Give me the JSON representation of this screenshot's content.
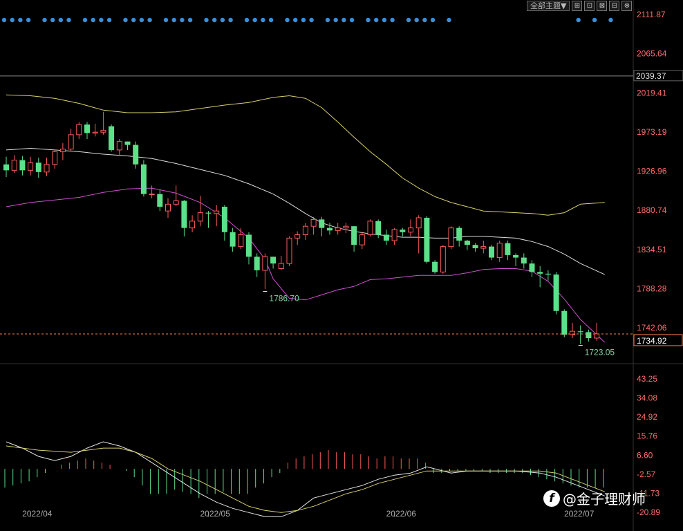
{
  "toolbar": {
    "theme_label": "全部主题▼",
    "buttons": [
      "⊞",
      "⊡",
      "⊠",
      "⊟",
      "⊗"
    ]
  },
  "watermark": {
    "logo": "f",
    "text": "@金子理财师"
  },
  "colors": {
    "up": "#ff5c5c",
    "down": "#5ce08a",
    "mid_band": "#dddddd",
    "upper_band": "#d8d070",
    "lower_band": "#d050d0",
    "dots": "#3a8fd8",
    "price_line": "#ff7f50"
  },
  "chart_data": [
    {
      "type": "candlestick",
      "y_ticks": [
        "2111.87",
        "2065.64",
        "2019.41",
        "1973.19",
        "1926.96",
        "1880.74",
        "1834.51",
        "1788.28",
        "1742.06"
      ],
      "ylim": [
        1721.0,
        2111.87
      ],
      "x_ticks": [
        "2022/04",
        "2022/05",
        "2022/06",
        "2022/07"
      ],
      "horizontal_line_label": "2039.37",
      "current_price": "1734.92",
      "annotations": [
        {
          "label": "1786.70",
          "value": 1786.7,
          "bar": 32
        },
        {
          "label": "1723.05",
          "value": 1723.05,
          "bar": 71
        }
      ],
      "candles": [
        [
          1935,
          1928,
          1944,
          1920
        ],
        [
          1928,
          1940,
          1946,
          1925
        ],
        [
          1940,
          1928,
          1945,
          1922
        ],
        [
          1928,
          1937,
          1944,
          1922
        ],
        [
          1937,
          1926,
          1943,
          1919
        ],
        [
          1926,
          1935,
          1943,
          1921
        ],
        [
          1935,
          1950,
          1952,
          1930
        ],
        [
          1950,
          1953,
          1960,
          1940
        ],
        [
          1953,
          1970,
          1977,
          1950
        ],
        [
          1970,
          1982,
          1985,
          1965
        ],
        [
          1982,
          1972,
          1985,
          1965
        ],
        [
          1972,
          1973,
          1983,
          1968
        ],
        [
          1973,
          1975,
          1997,
          1970
        ],
        [
          1980,
          1952,
          1982,
          1950
        ],
        [
          1952,
          1962,
          1965,
          1945
        ],
        [
          1962,
          1958,
          1962,
          1952
        ],
        [
          1958,
          1935,
          1962,
          1930
        ],
        [
          1935,
          1900,
          1940,
          1897
        ],
        [
          1900,
          1900,
          1910,
          1895
        ],
        [
          1900,
          1885,
          1905,
          1880
        ],
        [
          1880,
          1888,
          1895,
          1872
        ],
        [
          1888,
          1892,
          1910,
          1886
        ],
        [
          1892,
          1860,
          1893,
          1850
        ],
        [
          1860,
          1868,
          1875,
          1855
        ],
        [
          1868,
          1878,
          1898,
          1862
        ],
        [
          1878,
          1877,
          1880,
          1860
        ],
        [
          1877,
          1880,
          1887,
          1862
        ],
        [
          1885,
          1855,
          1887,
          1845
        ],
        [
          1855,
          1838,
          1860,
          1832
        ],
        [
          1838,
          1852,
          1860,
          1835
        ],
        [
          1852,
          1826,
          1855,
          1817
        ],
        [
          1826,
          1810,
          1830,
          1802
        ],
        [
          1810,
          1826,
          1830,
          1788
        ],
        [
          1826,
          1818,
          1822,
          1812
        ],
        [
          1812,
          1818,
          1827,
          1810
        ],
        [
          1818,
          1848,
          1850,
          1815
        ],
        [
          1848,
          1852,
          1856,
          1840
        ],
        [
          1852,
          1862,
          1866,
          1846
        ],
        [
          1862,
          1870,
          1873,
          1852
        ],
        [
          1870,
          1860,
          1873,
          1850
        ],
        [
          1860,
          1857,
          1866,
          1852
        ],
        [
          1857,
          1860,
          1866,
          1852
        ],
        [
          1860,
          1862,
          1866,
          1854
        ],
        [
          1862,
          1840,
          1862,
          1832
        ],
        [
          1840,
          1852,
          1855,
          1835
        ],
        [
          1852,
          1868,
          1870,
          1850
        ],
        [
          1868,
          1852,
          1870,
          1848
        ],
        [
          1852,
          1845,
          1858,
          1840
        ],
        [
          1845,
          1858,
          1860,
          1840
        ],
        [
          1858,
          1855,
          1860,
          1850
        ],
        [
          1855,
          1860,
          1870,
          1850
        ],
        [
          1860,
          1872,
          1875,
          1830
        ],
        [
          1872,
          1820,
          1874,
          1818
        ],
        [
          1820,
          1808,
          1822,
          1806
        ],
        [
          1808,
          1838,
          1840,
          1806
        ],
        [
          1838,
          1860,
          1862,
          1835
        ],
        [
          1860,
          1845,
          1862,
          1838
        ],
        [
          1845,
          1840,
          1846,
          1834
        ],
        [
          1840,
          1836,
          1842,
          1832
        ],
        [
          1836,
          1838,
          1845,
          1830
        ],
        [
          1838,
          1825,
          1840,
          1822
        ],
        [
          1825,
          1842,
          1845,
          1820
        ],
        [
          1842,
          1828,
          1845,
          1822
        ],
        [
          1828,
          1825,
          1830,
          1815
        ],
        [
          1825,
          1818,
          1830,
          1812
        ],
        [
          1818,
          1808,
          1822,
          1802
        ],
        [
          1808,
          1806,
          1815,
          1790
        ],
        [
          1806,
          1805,
          1810,
          1798
        ],
        [
          1805,
          1762,
          1808,
          1758
        ],
        [
          1762,
          1734,
          1764,
          1731
        ],
        [
          1734,
          1738,
          1748,
          1730
        ],
        [
          1738,
          1737,
          1745,
          1723.05
        ],
        [
          1737,
          1730,
          1740,
          1726
        ],
        [
          1730,
          1734.92,
          1748,
          1727
        ]
      ],
      "upper_band": [
        [
          0,
          2017
        ],
        [
          3,
          2016
        ],
        [
          6,
          2013
        ],
        [
          9,
          2007
        ],
        [
          12,
          1999
        ],
        [
          15,
          1996
        ],
        [
          18,
          1996
        ],
        [
          21,
          1997
        ],
        [
          24,
          2001
        ],
        [
          27,
          2005
        ],
        [
          30,
          2008
        ],
        [
          33,
          2014
        ],
        [
          35,
          2016
        ],
        [
          37,
          2013
        ],
        [
          39,
          2002
        ],
        [
          41,
          1985
        ],
        [
          43,
          1967
        ],
        [
          45,
          1950
        ],
        [
          47,
          1935
        ],
        [
          49,
          1919
        ],
        [
          51,
          1907
        ],
        [
          53,
          1897
        ],
        [
          55,
          1890
        ],
        [
          57,
          1885
        ],
        [
          59,
          1880
        ],
        [
          61,
          1879
        ],
        [
          63,
          1878
        ],
        [
          65,
          1877
        ],
        [
          67,
          1875
        ],
        [
          69,
          1878
        ],
        [
          71,
          1888
        ],
        [
          74,
          1890
        ]
      ],
      "middle_band": [
        [
          0,
          1952
        ],
        [
          3,
          1954
        ],
        [
          6,
          1952
        ],
        [
          9,
          1950
        ],
        [
          12,
          1947
        ],
        [
          15,
          1945
        ],
        [
          18,
          1942
        ],
        [
          21,
          1936
        ],
        [
          24,
          1929
        ],
        [
          27,
          1922
        ],
        [
          30,
          1912
        ],
        [
          33,
          1900
        ],
        [
          35,
          1889
        ],
        [
          37,
          1877
        ],
        [
          39,
          1866
        ],
        [
          41,
          1860
        ],
        [
          43,
          1856
        ],
        [
          45,
          1853
        ],
        [
          47,
          1851
        ],
        [
          49,
          1849
        ],
        [
          51,
          1849
        ],
        [
          53,
          1848
        ],
        [
          55,
          1848
        ],
        [
          57,
          1850
        ],
        [
          59,
          1850
        ],
        [
          61,
          1849
        ],
        [
          63,
          1848
        ],
        [
          65,
          1844
        ],
        [
          67,
          1838
        ],
        [
          69,
          1829
        ],
        [
          71,
          1818
        ],
        [
          74,
          1805
        ]
      ],
      "lower_band": [
        [
          0,
          1885
        ],
        [
          3,
          1890
        ],
        [
          6,
          1893
        ],
        [
          9,
          1896
        ],
        [
          12,
          1902
        ],
        [
          15,
          1906
        ],
        [
          18,
          1907
        ],
        [
          21,
          1901
        ],
        [
          24,
          1890
        ],
        [
          27,
          1872
        ],
        [
          30,
          1848
        ],
        [
          32,
          1823
        ],
        [
          33,
          1800
        ],
        [
          35,
          1777
        ],
        [
          37,
          1775
        ],
        [
          39,
          1781
        ],
        [
          41,
          1787
        ],
        [
          43,
          1791
        ],
        [
          45,
          1799
        ],
        [
          47,
          1800
        ],
        [
          49,
          1802
        ],
        [
          51,
          1804
        ],
        [
          53,
          1804
        ],
        [
          55,
          1804
        ],
        [
          57,
          1807
        ],
        [
          59,
          1811
        ],
        [
          61,
          1812
        ],
        [
          63,
          1812
        ],
        [
          65,
          1809
        ],
        [
          67,
          1797
        ],
        [
          69,
          1776
        ],
        [
          71,
          1752
        ],
        [
          74,
          1725
        ]
      ]
    },
    {
      "type": "macd",
      "y_ticks": [
        "43.25",
        "34.08",
        "24.92",
        "15.76",
        "6.60",
        "-2.57",
        "-11.73",
        "-20.89"
      ],
      "ylim": [
        -20.89,
        43.25
      ],
      "histogram": [
        -9,
        -8,
        -7,
        -6,
        -4,
        -2,
        0,
        2,
        3,
        4,
        5,
        4,
        3,
        2,
        0,
        -1,
        -4,
        -8,
        -12,
        -12,
        -12,
        -10,
        -11,
        -12,
        -14,
        -12,
        -12,
        -11,
        -12,
        -12,
        -12,
        -9,
        -7,
        -4,
        -2,
        3,
        5,
        6,
        7,
        8,
        9,
        8,
        8,
        7,
        7,
        6,
        5,
        6,
        6,
        5,
        5,
        5,
        3,
        -2,
        -2,
        -1,
        -1,
        -1,
        -1,
        -1,
        -2,
        -2,
        -2,
        -2,
        -2,
        -3,
        -4,
        -5,
        -6,
        -7,
        -8,
        -9,
        -9,
        -9,
        -9
      ],
      "dif": [
        [
          0,
          13
        ],
        [
          2,
          10
        ],
        [
          4,
          6
        ],
        [
          6,
          4
        ],
        [
          8,
          6
        ],
        [
          10,
          10
        ],
        [
          12,
          13
        ],
        [
          14,
          11
        ],
        [
          16,
          8
        ],
        [
          18,
          3
        ],
        [
          20,
          -2
        ],
        [
          22,
          -7
        ],
        [
          24,
          -12
        ],
        [
          26,
          -16
        ],
        [
          28,
          -19
        ],
        [
          30,
          -21
        ],
        [
          32,
          -23
        ],
        [
          34,
          -23
        ],
        [
          36,
          -20
        ],
        [
          38,
          -14
        ],
        [
          40,
          -12
        ],
        [
          42,
          -10
        ],
        [
          44,
          -8
        ],
        [
          46,
          -5
        ],
        [
          48,
          -3
        ],
        [
          50,
          -2
        ],
        [
          52,
          1
        ],
        [
          53,
          0
        ],
        [
          55,
          -2
        ],
        [
          57,
          -1
        ],
        [
          60,
          -1
        ],
        [
          63,
          -1
        ],
        [
          66,
          -2
        ],
        [
          68,
          -4
        ],
        [
          70,
          -7
        ],
        [
          72,
          -10
        ],
        [
          74,
          -13
        ]
      ],
      "dea": [
        [
          0,
          11
        ],
        [
          4,
          9
        ],
        [
          8,
          8
        ],
        [
          10,
          9
        ],
        [
          12,
          10
        ],
        [
          14,
          10
        ],
        [
          16,
          8
        ],
        [
          18,
          5
        ],
        [
          20,
          0
        ],
        [
          22,
          -3
        ],
        [
          24,
          -6
        ],
        [
          26,
          -10
        ],
        [
          28,
          -14
        ],
        [
          30,
          -18
        ],
        [
          32,
          -20
        ],
        [
          34,
          -21
        ],
        [
          36,
          -20
        ],
        [
          38,
          -18
        ],
        [
          40,
          -15
        ],
        [
          42,
          -12
        ],
        [
          44,
          -10
        ],
        [
          46,
          -7
        ],
        [
          48,
          -5
        ],
        [
          50,
          -3
        ],
        [
          52,
          -1
        ],
        [
          54,
          -1
        ],
        [
          56,
          -1
        ],
        [
          58,
          -1
        ],
        [
          60,
          -1
        ],
        [
          63,
          -1
        ],
        [
          66,
          -1
        ],
        [
          68,
          -2
        ],
        [
          70,
          -5
        ],
        [
          72,
          -8
        ],
        [
          74,
          -11
        ]
      ]
    }
  ]
}
